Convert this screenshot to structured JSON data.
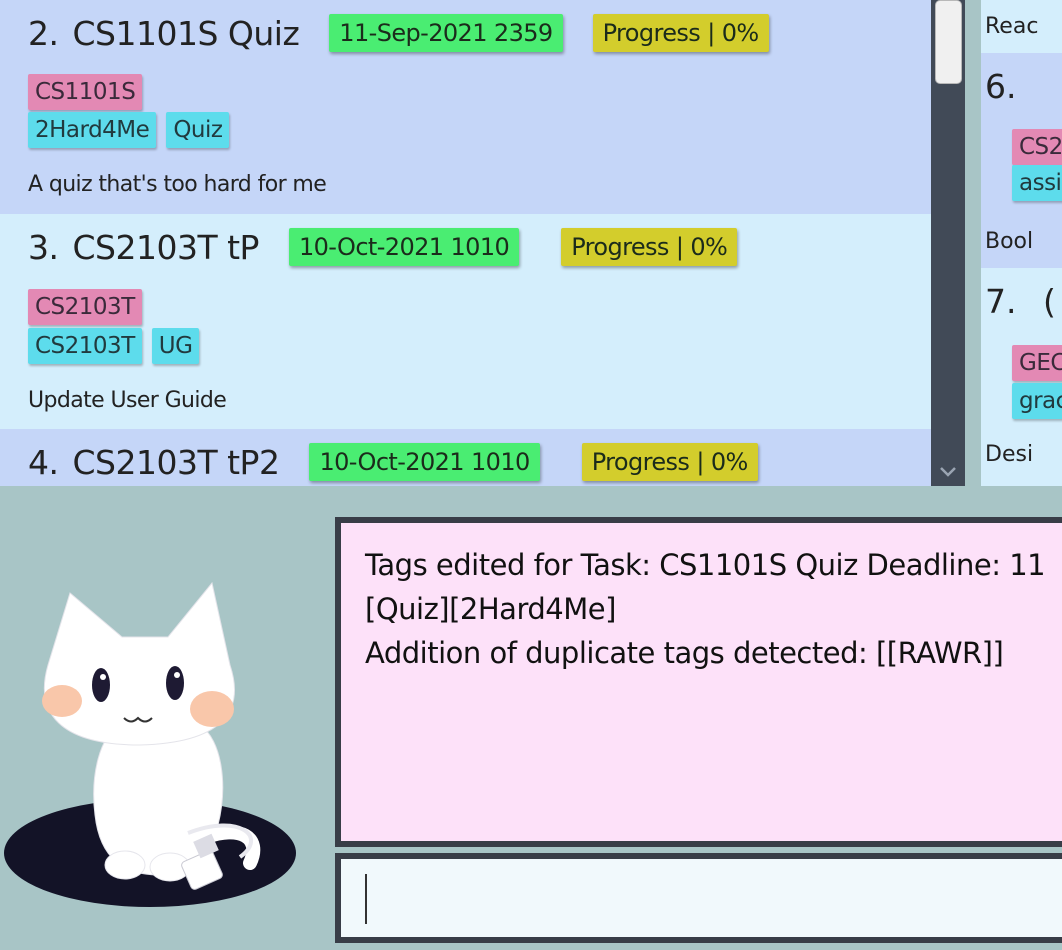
{
  "tasks": [
    {
      "index": "2.",
      "name": "CS1101S Quiz",
      "deadline": "11-Sep-2021 2359",
      "progress": "Progress | 0%",
      "module": "CS1101S",
      "tags": [
        "2Hard4Me",
        "Quiz"
      ],
      "description": "A quiz that's too hard for me"
    },
    {
      "index": "3.",
      "name": "CS2103T tP",
      "deadline": "10-Oct-2021 1010",
      "progress": "Progress | 0%",
      "module": "CS2103T",
      "tags": [
        "CS2103T",
        "UG"
      ],
      "description": "Update User Guide"
    },
    {
      "index": "4.",
      "name": "CS2103T tP2",
      "deadline": "10-Oct-2021 1010",
      "progress": "Progress | 0%"
    }
  ],
  "right_pane": {
    "top_desc": "Reac",
    "item6_index": "6.",
    "item6_module": "CS2",
    "item6_tag": "assi",
    "item6_desc": "Bool",
    "item7_index": "7.",
    "item7_title_fragment": "(",
    "item7_module": "GEC",
    "item7_tag": "grac",
    "item7_desc": "Desi"
  },
  "result": {
    "lines": [
      "Tags edited for Task: CS1101S Quiz Deadline: 11",
      "[Quiz][2Hard4Me]",
      "Addition of duplicate tags detected: [[RAWR]]"
    ]
  },
  "command": {
    "value": ""
  },
  "colors": {
    "deadline": "#4aed72",
    "progress": "#d3cd2c",
    "module_tag": "#e389b4",
    "label_tag": "#5ddcec",
    "result_bg": "#fde1f9",
    "background": "#a8c5c6"
  }
}
